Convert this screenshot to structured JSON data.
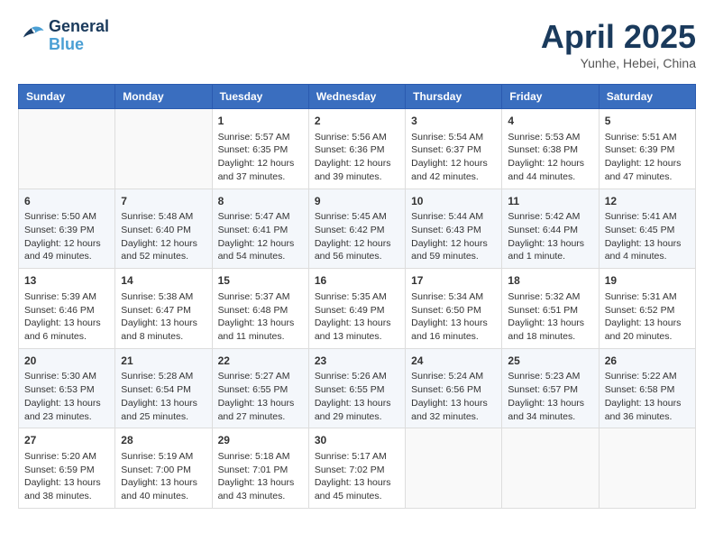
{
  "header": {
    "logo_line1": "General",
    "logo_line2": "Blue",
    "month": "April 2025",
    "location": "Yunhe, Hebei, China"
  },
  "days_of_week": [
    "Sunday",
    "Monday",
    "Tuesday",
    "Wednesday",
    "Thursday",
    "Friday",
    "Saturday"
  ],
  "weeks": [
    [
      {
        "day": "",
        "info": ""
      },
      {
        "day": "",
        "info": ""
      },
      {
        "day": "1",
        "info": "Sunrise: 5:57 AM\nSunset: 6:35 PM\nDaylight: 12 hours and 37 minutes."
      },
      {
        "day": "2",
        "info": "Sunrise: 5:56 AM\nSunset: 6:36 PM\nDaylight: 12 hours and 39 minutes."
      },
      {
        "day": "3",
        "info": "Sunrise: 5:54 AM\nSunset: 6:37 PM\nDaylight: 12 hours and 42 minutes."
      },
      {
        "day": "4",
        "info": "Sunrise: 5:53 AM\nSunset: 6:38 PM\nDaylight: 12 hours and 44 minutes."
      },
      {
        "day": "5",
        "info": "Sunrise: 5:51 AM\nSunset: 6:39 PM\nDaylight: 12 hours and 47 minutes."
      }
    ],
    [
      {
        "day": "6",
        "info": "Sunrise: 5:50 AM\nSunset: 6:39 PM\nDaylight: 12 hours and 49 minutes."
      },
      {
        "day": "7",
        "info": "Sunrise: 5:48 AM\nSunset: 6:40 PM\nDaylight: 12 hours and 52 minutes."
      },
      {
        "day": "8",
        "info": "Sunrise: 5:47 AM\nSunset: 6:41 PM\nDaylight: 12 hours and 54 minutes."
      },
      {
        "day": "9",
        "info": "Sunrise: 5:45 AM\nSunset: 6:42 PM\nDaylight: 12 hours and 56 minutes."
      },
      {
        "day": "10",
        "info": "Sunrise: 5:44 AM\nSunset: 6:43 PM\nDaylight: 12 hours and 59 minutes."
      },
      {
        "day": "11",
        "info": "Sunrise: 5:42 AM\nSunset: 6:44 PM\nDaylight: 13 hours and 1 minute."
      },
      {
        "day": "12",
        "info": "Sunrise: 5:41 AM\nSunset: 6:45 PM\nDaylight: 13 hours and 4 minutes."
      }
    ],
    [
      {
        "day": "13",
        "info": "Sunrise: 5:39 AM\nSunset: 6:46 PM\nDaylight: 13 hours and 6 minutes."
      },
      {
        "day": "14",
        "info": "Sunrise: 5:38 AM\nSunset: 6:47 PM\nDaylight: 13 hours and 8 minutes."
      },
      {
        "day": "15",
        "info": "Sunrise: 5:37 AM\nSunset: 6:48 PM\nDaylight: 13 hours and 11 minutes."
      },
      {
        "day": "16",
        "info": "Sunrise: 5:35 AM\nSunset: 6:49 PM\nDaylight: 13 hours and 13 minutes."
      },
      {
        "day": "17",
        "info": "Sunrise: 5:34 AM\nSunset: 6:50 PM\nDaylight: 13 hours and 16 minutes."
      },
      {
        "day": "18",
        "info": "Sunrise: 5:32 AM\nSunset: 6:51 PM\nDaylight: 13 hours and 18 minutes."
      },
      {
        "day": "19",
        "info": "Sunrise: 5:31 AM\nSunset: 6:52 PM\nDaylight: 13 hours and 20 minutes."
      }
    ],
    [
      {
        "day": "20",
        "info": "Sunrise: 5:30 AM\nSunset: 6:53 PM\nDaylight: 13 hours and 23 minutes."
      },
      {
        "day": "21",
        "info": "Sunrise: 5:28 AM\nSunset: 6:54 PM\nDaylight: 13 hours and 25 minutes."
      },
      {
        "day": "22",
        "info": "Sunrise: 5:27 AM\nSunset: 6:55 PM\nDaylight: 13 hours and 27 minutes."
      },
      {
        "day": "23",
        "info": "Sunrise: 5:26 AM\nSunset: 6:55 PM\nDaylight: 13 hours and 29 minutes."
      },
      {
        "day": "24",
        "info": "Sunrise: 5:24 AM\nSunset: 6:56 PM\nDaylight: 13 hours and 32 minutes."
      },
      {
        "day": "25",
        "info": "Sunrise: 5:23 AM\nSunset: 6:57 PM\nDaylight: 13 hours and 34 minutes."
      },
      {
        "day": "26",
        "info": "Sunrise: 5:22 AM\nSunset: 6:58 PM\nDaylight: 13 hours and 36 minutes."
      }
    ],
    [
      {
        "day": "27",
        "info": "Sunrise: 5:20 AM\nSunset: 6:59 PM\nDaylight: 13 hours and 38 minutes."
      },
      {
        "day": "28",
        "info": "Sunrise: 5:19 AM\nSunset: 7:00 PM\nDaylight: 13 hours and 40 minutes."
      },
      {
        "day": "29",
        "info": "Sunrise: 5:18 AM\nSunset: 7:01 PM\nDaylight: 13 hours and 43 minutes."
      },
      {
        "day": "30",
        "info": "Sunrise: 5:17 AM\nSunset: 7:02 PM\nDaylight: 13 hours and 45 minutes."
      },
      {
        "day": "",
        "info": ""
      },
      {
        "day": "",
        "info": ""
      },
      {
        "day": "",
        "info": ""
      }
    ]
  ]
}
